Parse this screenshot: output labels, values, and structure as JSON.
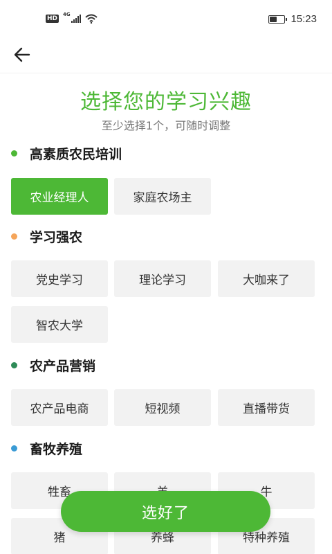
{
  "status_bar": {
    "hd": "HD",
    "network": "4G",
    "time": "15:23",
    "battery_level": 0.55
  },
  "nav": {
    "back_icon": "arrow-left-icon"
  },
  "header": {
    "title": "选择您的学习兴趣",
    "subtitle": "至少选择1个，可随时调整"
  },
  "sections": [
    {
      "title": "高素质农民培训",
      "dot_color": "#4db836",
      "chips": [
        {
          "label": "农业经理人",
          "selected": true
        },
        {
          "label": "家庭农场主",
          "selected": false
        }
      ]
    },
    {
      "title": "学习强农",
      "dot_color": "#f5a55a",
      "chips": [
        {
          "label": "党史学习",
          "selected": false
        },
        {
          "label": "理论学习",
          "selected": false
        },
        {
          "label": "大咖来了",
          "selected": false
        },
        {
          "label": "智农大学",
          "selected": false
        }
      ]
    },
    {
      "title": "农产品营销",
      "dot_color": "#2e8b57",
      "chips": [
        {
          "label": "农产品电商",
          "selected": false
        },
        {
          "label": "短视频",
          "selected": false
        },
        {
          "label": "直播带货",
          "selected": false
        }
      ]
    },
    {
      "title": "畜牧养殖",
      "dot_color": "#3a9bd5",
      "chips": [
        {
          "label": "牲畜",
          "selected": false
        },
        {
          "label": "羊",
          "selected": false
        },
        {
          "label": "牛",
          "selected": false
        },
        {
          "label": "猪",
          "selected": false
        },
        {
          "label": "养蜂",
          "selected": false
        },
        {
          "label": "特种养殖",
          "selected": false
        }
      ]
    }
  ],
  "footer": {
    "confirm_label": "选好了"
  },
  "colors": {
    "accent": "#4db836",
    "chip_bg": "#f2f2f2"
  }
}
